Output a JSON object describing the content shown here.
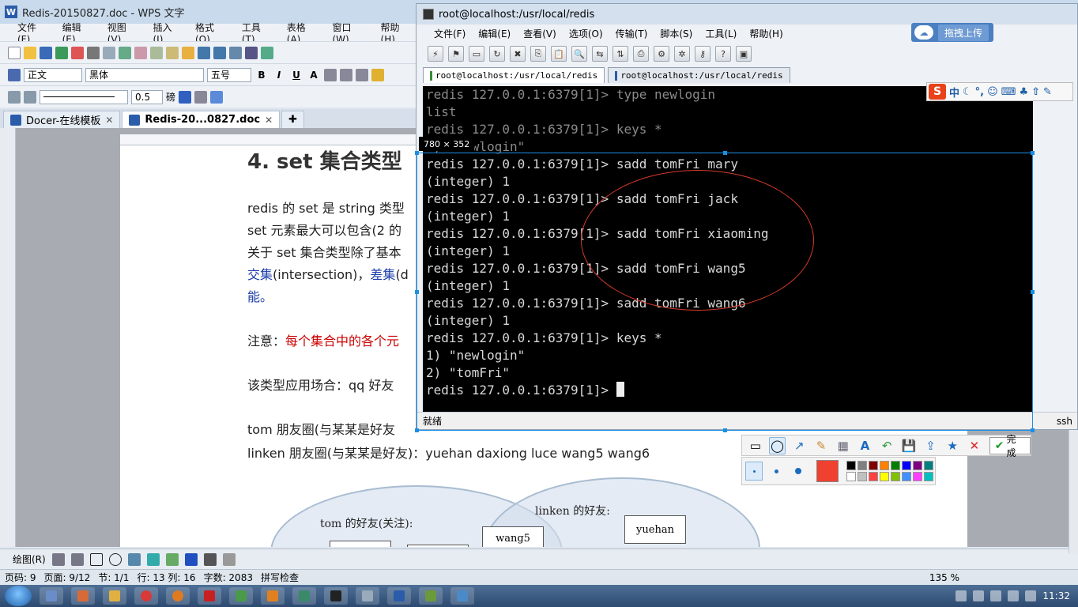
{
  "wps": {
    "title": "Redis-20150827.doc - WPS 文字",
    "menu": [
      "文件(F)",
      "编辑(E)",
      "视图(V)",
      "插入(I)",
      "格式(O)",
      "工具(T)",
      "表格(A)",
      "窗口(W)",
      "帮助(H)"
    ],
    "style_value": "正文",
    "font_value": "黑体",
    "size_value": "五号",
    "line_width": "0.5",
    "line_unit": "磅",
    "tabs": [
      {
        "label": "Docer-在线模板"
      },
      {
        "label": "Redis-20...0827.doc"
      }
    ],
    "doc": {
      "heading": "4. set 集合类型",
      "p1": "redis 的 set 是 string 类型",
      "p2": "set 元素最大可以包含(2 的",
      "p3": "关于 set 集合类型除了基本",
      "p4_a": "交集",
      "p4_b": "(intersection)，",
      "p4_c": "差集",
      "p4_d": "(d",
      "p5": "能。",
      "note_a": "注意：",
      "note_b": "每个集合中的各个元",
      "usage": "该类型应用场合：qq 好友",
      "tom_line": "tom 朋友圈(与某某是好友",
      "linken_line": "linken 朋友圈(与某某是好友)：yuehan   daxiong   luce   wang5   wang6",
      "tom_label": "tom 的好友(关注):",
      "linken_label": "linken 的好友:",
      "box_wang5": "wang5",
      "box_yuehan": "yuehan"
    },
    "draw_label": "绘图(R)",
    "status": {
      "page": "页码: 9",
      "pages": "页面: 9/12",
      "section": "节: 1/1",
      "line_col": "行: 13  列: 16",
      "words": "字数: 2083",
      "spell": "拼写检查",
      "zoom": "135 %"
    }
  },
  "ssh": {
    "title": "root@localhost:/usr/local/redis",
    "menu": [
      "文件(F)",
      "编辑(E)",
      "查看(V)",
      "选项(O)",
      "传输(T)",
      "脚本(S)",
      "工具(L)",
      "帮助(H)"
    ],
    "upload_label": "拖拽上传",
    "tabs": [
      {
        "label": "root@localhost:/usr/local/redis"
      },
      {
        "label": "root@localhost:/usr/local/redis"
      }
    ],
    "terminal_lines": [
      "redis 127.0.0.1:6379[1]> type newlogin",
      "list",
      "redis 127.0.0.1:6379[1]> keys *",
      "1) \"newlogin\"",
      "redis 127.0.0.1:6379[1]> sadd tomFri mary",
      "(integer) 1",
      "redis 127.0.0.1:6379[1]> sadd tomFri jack",
      "(integer) 1",
      "redis 127.0.0.1:6379[1]> sadd tomFri xiaoming",
      "(integer) 1",
      "redis 127.0.0.1:6379[1]> sadd tomFri wang5",
      "(integer) 1",
      "redis 127.0.0.1:6379[1]> sadd tomFri wang6",
      "(integer) 1",
      "redis 127.0.0.1:6379[1]> keys *",
      "1) \"newlogin\"",
      "2) \"tomFri\""
    ],
    "prompt": "redis 127.0.0.1:6379[1]> ",
    "status_left": "就绪",
    "status_right": "ssh"
  },
  "capture": {
    "size_tip": "780 × 352",
    "done_label": "完成",
    "current_color": "#f04030",
    "palette": [
      "#000000",
      "#808080",
      "#800000",
      "#ff8000",
      "#008000",
      "#0000ff",
      "#800080",
      "#008080",
      "#ffffff",
      "#c0c0c0",
      "#ff4040",
      "#ffff00",
      "#80c000",
      "#4090ff",
      "#ff40ff",
      "#00c0c0"
    ]
  },
  "taskbar": {
    "clock": "11:32"
  }
}
